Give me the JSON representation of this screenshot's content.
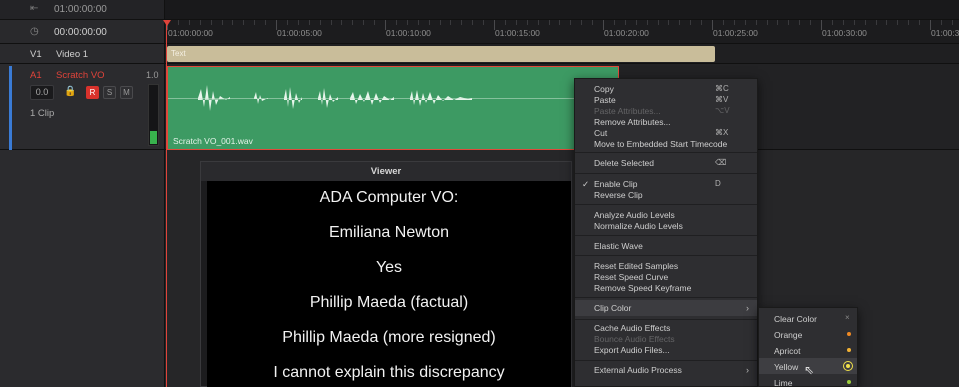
{
  "ruler": {
    "header_timecode": "01:00:00:00",
    "header_icon": "in-point-icon",
    "ticks": [
      "01:00:00:00",
      "01:00:05:00",
      "01:00:10:00",
      "01:00:15:00",
      "01:00:20:00",
      "01:00:25:00",
      "01:00:30:00",
      "01:00:35"
    ]
  },
  "timecode_row": {
    "timecode": "00:00:00:00",
    "icon": "clock-icon"
  },
  "video_track": {
    "id": "V1",
    "name": "Video 1",
    "clip_label": "Text",
    "clip_color": "#c9bd9a"
  },
  "audio_track": {
    "id": "A1",
    "name": "Scratch VO",
    "value": "1.0",
    "volume": "0.0",
    "buttons": [
      "R",
      "S",
      "M"
    ],
    "clip_count": "1 Clip",
    "clip_name": "Scratch VO_001.wav",
    "clip_color": "#3d9a63",
    "meter_level": 0.22
  },
  "viewer": {
    "title": "Viewer",
    "lines": [
      "ADA Computer VO:",
      "Emiliana Newton",
      "Yes",
      "Phillip Maeda (factual)",
      "Phillip Maeda (more resigned)",
      "I cannot explain this discrepancy"
    ]
  },
  "context_menu": {
    "items": [
      {
        "label": "Copy",
        "shortcut": "⌘C",
        "disabled": false
      },
      {
        "label": "Paste",
        "shortcut": "⌘V",
        "disabled": false
      },
      {
        "label": "Paste Attributes...",
        "shortcut": "⌥V",
        "disabled": true
      },
      {
        "label": "Remove Attributes...",
        "shortcut": "",
        "disabled": false
      },
      {
        "label": "Cut",
        "shortcut": "⌘X",
        "disabled": false
      },
      {
        "label": "Move to Embedded Start Timecode",
        "shortcut": "",
        "disabled": false
      },
      {
        "label": "Delete Selected",
        "shortcut": "⌫",
        "disabled": false
      },
      {
        "label": "Enable Clip",
        "shortcut": "D",
        "disabled": false,
        "checked": true
      },
      {
        "label": "Reverse Clip",
        "shortcut": "",
        "disabled": false
      },
      {
        "label": "Analyze Audio Levels",
        "shortcut": "",
        "disabled": false
      },
      {
        "label": "Normalize Audio Levels",
        "shortcut": "",
        "disabled": false
      },
      {
        "label": "Elastic Wave",
        "shortcut": "",
        "disabled": false
      },
      {
        "label": "Reset Edited Samples",
        "shortcut": "",
        "disabled": false
      },
      {
        "label": "Reset Speed Curve",
        "shortcut": "",
        "disabled": false
      },
      {
        "label": "Remove Speed Keyframe",
        "shortcut": "",
        "disabled": false
      },
      {
        "label": "Clip Color",
        "shortcut": "",
        "disabled": false,
        "submenu": true
      },
      {
        "label": "Cache Audio Effects",
        "shortcut": "",
        "disabled": false
      },
      {
        "label": "Bounce Audio Effects",
        "shortcut": "",
        "disabled": true
      },
      {
        "label": "Export Audio Files...",
        "shortcut": "",
        "disabled": false
      },
      {
        "label": "External Audio Process",
        "shortcut": "",
        "disabled": false,
        "submenu": true
      }
    ],
    "check_glyph": "✓",
    "arrow_glyph": "›"
  },
  "clip_color_submenu": {
    "items": [
      {
        "label": "Clear Color",
        "color": "",
        "state": "clear"
      },
      {
        "label": "Orange",
        "color": "#f08a24",
        "state": "normal"
      },
      {
        "label": "Apricot",
        "color": "#f2b134",
        "state": "normal"
      },
      {
        "label": "Yellow",
        "color": "#f0e04a",
        "state": "selected"
      },
      {
        "label": "Lime",
        "color": "#9ccc3c",
        "state": "normal"
      }
    ],
    "clear_glyph": "×"
  }
}
